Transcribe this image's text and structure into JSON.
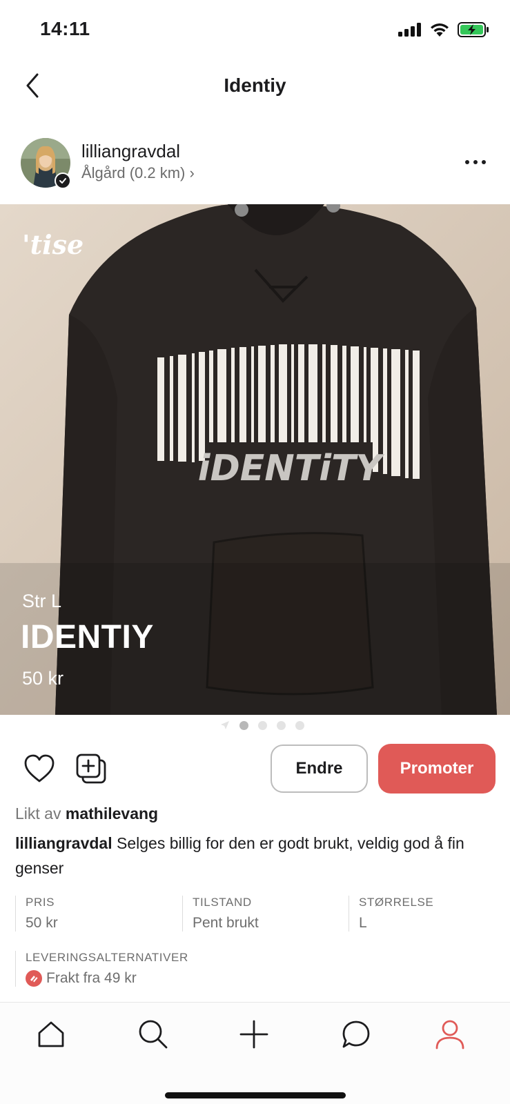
{
  "status": {
    "time": "14:11"
  },
  "nav": {
    "title": "Identiy"
  },
  "seller": {
    "username": "lilliangravdal",
    "location": "Ålgård (0.2 km) ›"
  },
  "image": {
    "watermark": "'tise",
    "size_text": "Str L",
    "title": "IDENTIY",
    "price": "50 kr",
    "garment_print": "iDENTiTY",
    "pages": 4,
    "active_page": 1
  },
  "actions": {
    "edit_label": "Endre",
    "promote_label": "Promoter"
  },
  "likes": {
    "prefix": "Likt av",
    "user": "mathilevang"
  },
  "description": {
    "user": "lilliangravdal",
    "text": " Selges billig for den er godt brukt, veldig god å fin genser"
  },
  "details": {
    "price_label": "PRIS",
    "price_value": "50 kr",
    "condition_label": "TILSTAND",
    "condition_value": "Pent brukt",
    "size_label": "STØRRELSE",
    "size_value": "L",
    "delivery_label": "LEVERINGSALTERNATIVER",
    "delivery_value": "Frakt fra 49 kr"
  },
  "colors": {
    "accent": "#e05a57",
    "hoodie": "#2b2624",
    "background_wall": "#d9cbbd"
  },
  "tabs": [
    "home-icon",
    "search-icon",
    "plus-icon",
    "chat-icon",
    "profile-icon"
  ],
  "active_tab": "profile-icon"
}
